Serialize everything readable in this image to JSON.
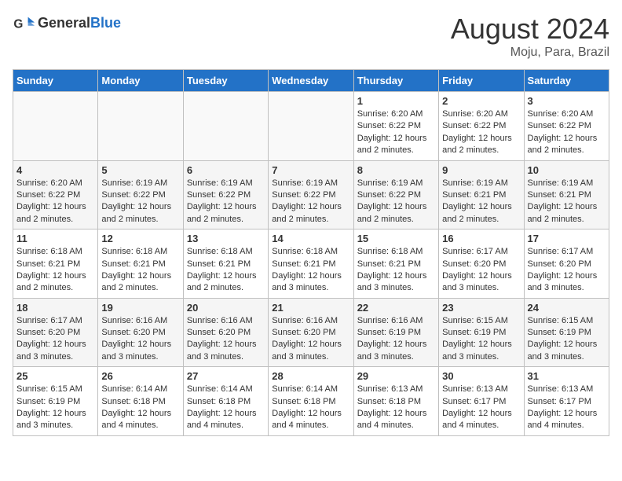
{
  "header": {
    "logo_text_general": "General",
    "logo_text_blue": "Blue",
    "month": "August 2024",
    "location": "Moju, Para, Brazil"
  },
  "weekdays": [
    "Sunday",
    "Monday",
    "Tuesday",
    "Wednesday",
    "Thursday",
    "Friday",
    "Saturday"
  ],
  "weeks": [
    [
      {
        "day": "",
        "info": ""
      },
      {
        "day": "",
        "info": ""
      },
      {
        "day": "",
        "info": ""
      },
      {
        "day": "",
        "info": ""
      },
      {
        "day": "1",
        "info": "Sunrise: 6:20 AM\nSunset: 6:22 PM\nDaylight: 12 hours and 2 minutes."
      },
      {
        "day": "2",
        "info": "Sunrise: 6:20 AM\nSunset: 6:22 PM\nDaylight: 12 hours and 2 minutes."
      },
      {
        "day": "3",
        "info": "Sunrise: 6:20 AM\nSunset: 6:22 PM\nDaylight: 12 hours and 2 minutes."
      }
    ],
    [
      {
        "day": "4",
        "info": "Sunrise: 6:20 AM\nSunset: 6:22 PM\nDaylight: 12 hours and 2 minutes."
      },
      {
        "day": "5",
        "info": "Sunrise: 6:19 AM\nSunset: 6:22 PM\nDaylight: 12 hours and 2 minutes."
      },
      {
        "day": "6",
        "info": "Sunrise: 6:19 AM\nSunset: 6:22 PM\nDaylight: 12 hours and 2 minutes."
      },
      {
        "day": "7",
        "info": "Sunrise: 6:19 AM\nSunset: 6:22 PM\nDaylight: 12 hours and 2 minutes."
      },
      {
        "day": "8",
        "info": "Sunrise: 6:19 AM\nSunset: 6:22 PM\nDaylight: 12 hours and 2 minutes."
      },
      {
        "day": "9",
        "info": "Sunrise: 6:19 AM\nSunset: 6:21 PM\nDaylight: 12 hours and 2 minutes."
      },
      {
        "day": "10",
        "info": "Sunrise: 6:19 AM\nSunset: 6:21 PM\nDaylight: 12 hours and 2 minutes."
      }
    ],
    [
      {
        "day": "11",
        "info": "Sunrise: 6:18 AM\nSunset: 6:21 PM\nDaylight: 12 hours and 2 minutes."
      },
      {
        "day": "12",
        "info": "Sunrise: 6:18 AM\nSunset: 6:21 PM\nDaylight: 12 hours and 2 minutes."
      },
      {
        "day": "13",
        "info": "Sunrise: 6:18 AM\nSunset: 6:21 PM\nDaylight: 12 hours and 2 minutes."
      },
      {
        "day": "14",
        "info": "Sunrise: 6:18 AM\nSunset: 6:21 PM\nDaylight: 12 hours and 3 minutes."
      },
      {
        "day": "15",
        "info": "Sunrise: 6:18 AM\nSunset: 6:21 PM\nDaylight: 12 hours and 3 minutes."
      },
      {
        "day": "16",
        "info": "Sunrise: 6:17 AM\nSunset: 6:20 PM\nDaylight: 12 hours and 3 minutes."
      },
      {
        "day": "17",
        "info": "Sunrise: 6:17 AM\nSunset: 6:20 PM\nDaylight: 12 hours and 3 minutes."
      }
    ],
    [
      {
        "day": "18",
        "info": "Sunrise: 6:17 AM\nSunset: 6:20 PM\nDaylight: 12 hours and 3 minutes."
      },
      {
        "day": "19",
        "info": "Sunrise: 6:16 AM\nSunset: 6:20 PM\nDaylight: 12 hours and 3 minutes."
      },
      {
        "day": "20",
        "info": "Sunrise: 6:16 AM\nSunset: 6:20 PM\nDaylight: 12 hours and 3 minutes."
      },
      {
        "day": "21",
        "info": "Sunrise: 6:16 AM\nSunset: 6:20 PM\nDaylight: 12 hours and 3 minutes."
      },
      {
        "day": "22",
        "info": "Sunrise: 6:16 AM\nSunset: 6:19 PM\nDaylight: 12 hours and 3 minutes."
      },
      {
        "day": "23",
        "info": "Sunrise: 6:15 AM\nSunset: 6:19 PM\nDaylight: 12 hours and 3 minutes."
      },
      {
        "day": "24",
        "info": "Sunrise: 6:15 AM\nSunset: 6:19 PM\nDaylight: 12 hours and 3 minutes."
      }
    ],
    [
      {
        "day": "25",
        "info": "Sunrise: 6:15 AM\nSunset: 6:19 PM\nDaylight: 12 hours and 3 minutes."
      },
      {
        "day": "26",
        "info": "Sunrise: 6:14 AM\nSunset: 6:18 PM\nDaylight: 12 hours and 4 minutes."
      },
      {
        "day": "27",
        "info": "Sunrise: 6:14 AM\nSunset: 6:18 PM\nDaylight: 12 hours and 4 minutes."
      },
      {
        "day": "28",
        "info": "Sunrise: 6:14 AM\nSunset: 6:18 PM\nDaylight: 12 hours and 4 minutes."
      },
      {
        "day": "29",
        "info": "Sunrise: 6:13 AM\nSunset: 6:18 PM\nDaylight: 12 hours and 4 minutes."
      },
      {
        "day": "30",
        "info": "Sunrise: 6:13 AM\nSunset: 6:17 PM\nDaylight: 12 hours and 4 minutes."
      },
      {
        "day": "31",
        "info": "Sunrise: 6:13 AM\nSunset: 6:17 PM\nDaylight: 12 hours and 4 minutes."
      }
    ]
  ]
}
